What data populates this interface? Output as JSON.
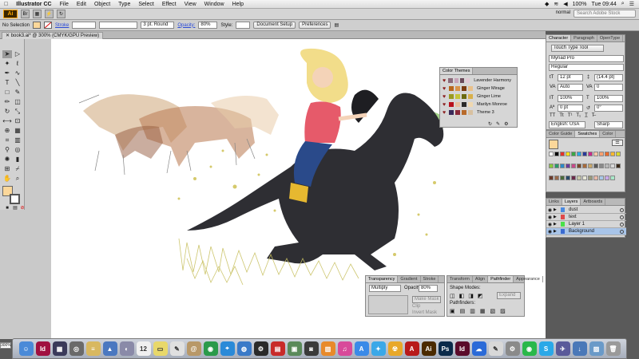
{
  "menubar": {
    "apple": "",
    "app_name": "Illustrator CC",
    "items": [
      "File",
      "Edit",
      "Object",
      "Type",
      "Select",
      "Effect",
      "View",
      "Window",
      "Help"
    ],
    "battery": "100%",
    "time": "Tue 09:44"
  },
  "appbar": {
    "logo": "Ai",
    "workspace": "normal",
    "search_placeholder": "Search Adobe Stock"
  },
  "control": {
    "selection": "No Selection",
    "stroke_label": "Stroke",
    "brush": "3 pt. Round",
    "opacity_label": "Opacity:",
    "opacity": "80%",
    "style_label": "Style:",
    "document_setup": "Document Setup",
    "preferences": "Preferences"
  },
  "document": {
    "tab": "book3.ai* @ 300% (CMYK/GPU Preview)",
    "zoom": "300%"
  },
  "color_themes": {
    "title": "Color Themes",
    "themes": [
      {
        "name": "Lavender Harmony",
        "colors": [
          "#8b6a7a",
          "#c7a4b8",
          "#6a4a5a",
          "#e2c9d4"
        ]
      },
      {
        "name": "Ginger Mirage",
        "colors": [
          "#b8671c",
          "#d9944a",
          "#7a3a10",
          "#e9c08a"
        ]
      },
      {
        "name": "Ginger Lime",
        "colors": [
          "#9a9a20",
          "#c5c53a",
          "#6a6a10",
          "#d8b04a"
        ]
      },
      {
        "name": "Marilyn Monroe",
        "colors": [
          "#b8101c",
          "#e8c0a0",
          "#2a2a2a",
          "#f0d8b0"
        ]
      },
      {
        "name": "Theme 3",
        "colors": [
          "#3a2a5a",
          "#8a2a3a",
          "#b86a2a",
          "#d8c0a0"
        ]
      }
    ]
  },
  "character_panel": {
    "tabs": [
      "Character",
      "Paragraph",
      "OpenType"
    ],
    "touch_type": "Touch Type Tool",
    "font": "Myriad Pro",
    "style": "Regular",
    "size": "12 pt",
    "leading": "(14.4 pt)",
    "kerning": "Auto",
    "tracking": "0",
    "hscale": "100%",
    "vscale": "100%",
    "baseline": "0 pt",
    "rotation": "0°",
    "language": "English: USA",
    "aa": "Sharp"
  },
  "swatches_panel": {
    "tabs": [
      "Color Guide",
      "Swatches",
      "Color"
    ]
  },
  "layers_panel": {
    "tabs": [
      "Links",
      "Layers",
      "Artboards"
    ],
    "layers": [
      {
        "name": "dust",
        "color": "#4a8ae0"
      },
      {
        "name": "text",
        "color": "#e04a4a"
      },
      {
        "name": "Layer 1",
        "color": "#4ae04a"
      },
      {
        "name": "Background",
        "color": "#3a6ad0"
      }
    ]
  },
  "transparency_panel": {
    "tabs": [
      "Transparency",
      "Gradient",
      "Stroke"
    ],
    "mode": "Multiply",
    "opacity_label": "Opacity:",
    "opacity": "80%",
    "make_mask": "Make Mask",
    "clip": "Clip",
    "invert_mask": "Invert Mask"
  },
  "pathfinder_panel": {
    "tabs": [
      "Transform",
      "Align",
      "Pathfinder",
      "Appearance"
    ],
    "shape_modes": "Shape Modes:",
    "expand": "Expand",
    "pathfinders": "Pathfinders:"
  },
  "dock": {
    "apps": [
      {
        "name": "Finder",
        "color": "#4a8ad8",
        "glyph": "☺"
      },
      {
        "name": "InDesign",
        "color": "#a01040",
        "glyph": "Id"
      },
      {
        "name": "Mission Control",
        "color": "#3a3a5a",
        "glyph": "▦"
      },
      {
        "name": "Screenshot",
        "color": "#6a6a6a",
        "glyph": "◎"
      },
      {
        "name": "Notes",
        "color": "#d8b860",
        "glyph": "≡"
      },
      {
        "name": "iPhoto",
        "color": "#4a78c0",
        "glyph": "▲"
      },
      {
        "name": "Preview",
        "color": "#8a8aa8",
        "glyph": "◐"
      },
      {
        "name": "Calendar",
        "color": "#f0f0f0",
        "glyph": "12"
      },
      {
        "name": "Stickies",
        "color": "#e8d86a",
        "glyph": "▭"
      },
      {
        "name": "TextEdit",
        "color": "#e0e0e0",
        "glyph": "✎"
      },
      {
        "name": "Contacts",
        "color": "#b89868",
        "glyph": "@"
      },
      {
        "name": "Chrome",
        "color": "#2a9a4a",
        "glyph": "◉"
      },
      {
        "name": "Safari",
        "color": "#2a8ad8",
        "glyph": "⌖"
      },
      {
        "name": "Globe",
        "color": "#3a7ac8",
        "glyph": "◍"
      },
      {
        "name": "Activity",
        "color": "#2a2a2a",
        "glyph": "⚙"
      },
      {
        "name": "PDF",
        "color": "#c82a2a",
        "glyph": "▤"
      },
      {
        "name": "Photo",
        "color": "#5a8a5a",
        "glyph": "▣"
      },
      {
        "name": "Photo Booth",
        "color": "#3a3a3a",
        "glyph": "◙"
      },
      {
        "name": "iBooks",
        "color": "#e88a2a",
        "glyph": "▥"
      },
      {
        "name": "iTunes",
        "color": "#d84a9a",
        "glyph": "♫"
      },
      {
        "name": "App Store",
        "color": "#3a8ae8",
        "glyph": "A"
      },
      {
        "name": "Twitter",
        "color": "#3aa8e8",
        "glyph": "✦"
      },
      {
        "name": "Burn",
        "color": "#e8a82a",
        "glyph": "☢"
      },
      {
        "name": "Acrobat",
        "color": "#b81a1a",
        "glyph": "A"
      },
      {
        "name": "Illustrator",
        "color": "#4a2a00",
        "glyph": "Ai"
      },
      {
        "name": "Photoshop",
        "color": "#0a2a4a",
        "glyph": "Ps"
      },
      {
        "name": "InDesign CC",
        "color": "#5a0a2a",
        "glyph": "Id"
      },
      {
        "name": "Creative Cloud",
        "color": "#2a6ad8",
        "glyph": "☁"
      },
      {
        "name": "TextWrangler",
        "color": "#d8d8d8",
        "glyph": "✎"
      },
      {
        "name": "System Prefs",
        "color": "#8a8a8a",
        "glyph": "⚙"
      },
      {
        "name": "Spotify",
        "color": "#2ab84a",
        "glyph": "◉"
      },
      {
        "name": "Skype",
        "color": "#2aa8e8",
        "glyph": "S"
      },
      {
        "name": "Launchpad",
        "color": "#5a5a9a",
        "glyph": "✈"
      },
      {
        "name": "Downloads",
        "color": "#4a78b8",
        "glyph": "↓"
      },
      {
        "name": "Pictures",
        "color": "#6a9ac8",
        "glyph": "▨"
      },
      {
        "name": "Trash",
        "color": "#9a9a9a",
        "glyph": "🗑"
      }
    ]
  },
  "colors": {
    "accent": "#f7a300",
    "fill_color": "#fbd79a"
  }
}
